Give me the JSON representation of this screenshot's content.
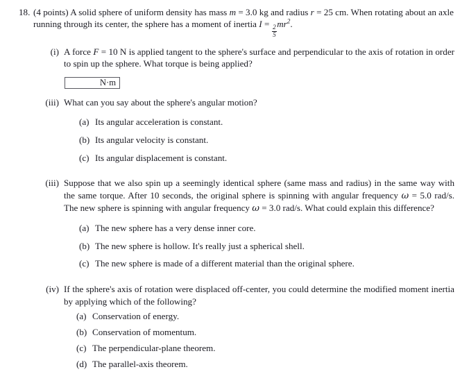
{
  "problem": {
    "number": "18.",
    "points": "(4 points)",
    "stem_part1": "A solid sphere of uniform density has mass",
    "var_m": "m",
    "eq1": "= 3.0 kg and radius",
    "var_r": "r",
    "eq2": "= 25 cm. When rotating about an axle running through its center, the sphere has a moment of inertia",
    "var_I": "I",
    "eq3": "=",
    "frac_num": "2",
    "frac_den": "5",
    "formula_tail": "mr",
    "formula_exp": "2",
    "period": "."
  },
  "subparts": [
    {
      "label": "(i)",
      "text_pre": "A force",
      "var_F": "F",
      "text_post": "= 10 N is applied tangent to the sphere's surface and perpendicular to the axis of rotation in order to spin up the sphere. What torque is being applied?",
      "answer_box": {
        "value": "",
        "unit": "N·m"
      },
      "choices": []
    },
    {
      "label": "(iii)",
      "text": "What can you say about the sphere's angular motion?",
      "choices": [
        {
          "label": "(a)",
          "text": "Its angular acceleration is constant."
        },
        {
          "label": "(b)",
          "text": "Its angular velocity is constant."
        },
        {
          "label": "(c)",
          "text": "Its angular displacement is constant."
        }
      ]
    },
    {
      "label": "(iii)",
      "text_seg1": "Suppose that we also spin up a seemingly identical sphere (same mass and radius) in the same way with the same torque. After 10 seconds, the original sphere is spinning with angular frequency",
      "omega1": "ω",
      "text_seg2": "= 5.0 rad/s. The new sphere is spinning with angular frequency",
      "omega2": "ω",
      "text_seg3": "= 3.0 rad/s. What could explain this difference?",
      "choices": [
        {
          "label": "(a)",
          "text": "The new sphere has a very dense inner core."
        },
        {
          "label": "(b)",
          "text": "The new sphere is hollow. It's really just a spherical shell."
        },
        {
          "label": "(c)",
          "text": "The new sphere is made of a different material than the original sphere."
        }
      ]
    },
    {
      "label": "(iv)",
      "text": "If the sphere's axis of rotation were displaced off-center, you could determine the modified moment inertia by applying which of the following?",
      "choices": [
        {
          "label": "(a)",
          "text": "Conservation of energy."
        },
        {
          "label": "(b)",
          "text": "Conservation of momentum."
        },
        {
          "label": "(c)",
          "text": "The perpendicular-plane theorem."
        },
        {
          "label": "(d)",
          "text": "The parallel-axis theorem."
        }
      ]
    }
  ],
  "colors": {
    "text": "#1a1a22",
    "page_background": "#ffffff",
    "box_border": "#58585f"
  }
}
